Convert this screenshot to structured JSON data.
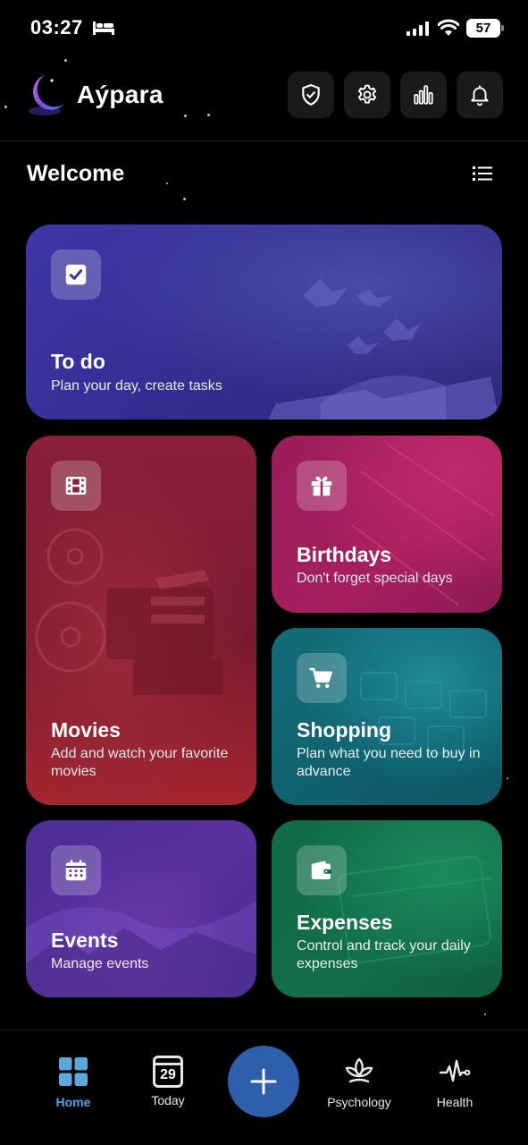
{
  "status_bar": {
    "time": "03:27",
    "battery": "57",
    "icons": [
      "bed-icon",
      "signal-icon",
      "wifi-icon",
      "battery-icon"
    ]
  },
  "header": {
    "app_name": "Aýpara",
    "logo": "crescent-moon-logo",
    "actions": [
      {
        "name": "shield-check-icon"
      },
      {
        "name": "gear-icon"
      },
      {
        "name": "bar-chart-icon"
      },
      {
        "name": "bell-icon"
      }
    ]
  },
  "welcome": {
    "title": "Welcome",
    "menu_icon": "list-icon"
  },
  "cards": {
    "todo": {
      "title": "To do",
      "subtitle": "Plan your day, create tasks",
      "icon": "checkbox-icon",
      "color": "#3a34a0"
    },
    "movies": {
      "title": "Movies",
      "subtitle": "Add and watch your favorite movies",
      "icon": "film-icon",
      "color": "#8a1f3a"
    },
    "birthdays": {
      "title": "Birthdays",
      "subtitle": "Don't forget special days",
      "icon": "gift-icon",
      "color": "#a01e5c"
    },
    "shopping": {
      "title": "Shopping",
      "subtitle": "Plan what you need to buy in advance",
      "icon": "cart-icon",
      "color": "#136c78"
    },
    "events": {
      "title": "Events",
      "subtitle": "Manage events",
      "icon": "calendar-icon",
      "color": "#4f2e98"
    },
    "expenses": {
      "title": "Expenses",
      "subtitle": "Control and track your daily expenses",
      "icon": "wallet-icon",
      "color": "#0f6b46"
    }
  },
  "bottom_nav": {
    "home": {
      "label": "Home",
      "active": true,
      "icon": "grid-icon"
    },
    "today": {
      "label": "Today",
      "day": "29",
      "icon": "calendar-day-icon"
    },
    "add": {
      "icon": "plus-icon",
      "color": "#2d5fab"
    },
    "psychology": {
      "label": "Psychology",
      "icon": "lotus-icon"
    },
    "health": {
      "label": "Health",
      "icon": "heartbeat-icon"
    }
  },
  "colors": {
    "background": "#000000",
    "accent": "#4aa3e6",
    "button_bg": "#1a1a1c"
  }
}
